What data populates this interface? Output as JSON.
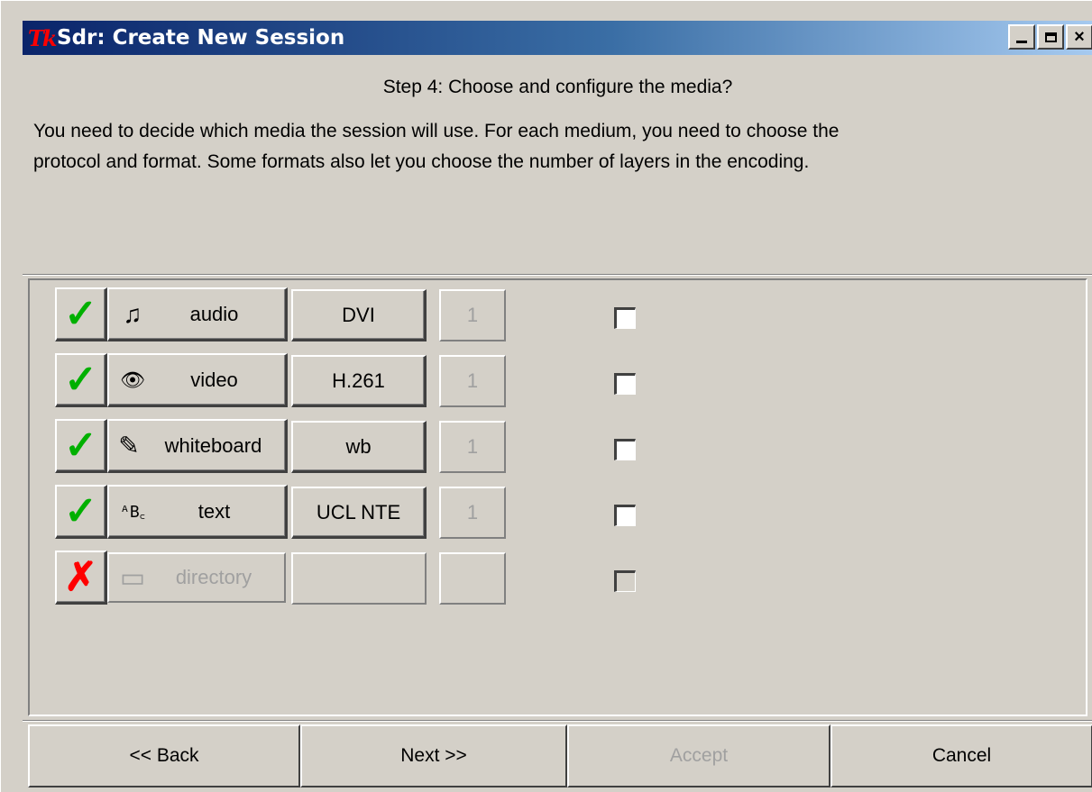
{
  "window": {
    "logo": "Tk",
    "title": "Sdr: Create New Session",
    "controls": {
      "minimize": "minimize",
      "maximize": "maximize",
      "close": "×"
    }
  },
  "step": "Step 4: Choose and configure the media?",
  "description_line1": "You need to decide which media the session will use.  For each medium, you need to choose the",
  "description_line2": "protocol and format.  Some formats also let you choose the number of layers in the encoding.",
  "media": [
    {
      "enabled_mark": "✓",
      "icon": "music-note-icon",
      "icon_glyph": "♫",
      "label": "audio",
      "format": "DVI",
      "layers": "1"
    },
    {
      "enabled_mark": "✓",
      "icon": "eye-icon",
      "icon_glyph": "👁",
      "label": "video",
      "format": "H.261",
      "layers": "1"
    },
    {
      "enabled_mark": "✓",
      "icon": "pen-icon",
      "icon_glyph": "✎",
      "label": "whiteboard",
      "format": "wb",
      "layers": "1"
    },
    {
      "enabled_mark": "✓",
      "icon": "abc-icon",
      "icon_glyph": "ᴬB꜀",
      "label": "text",
      "format": "UCL NTE",
      "layers": "1"
    },
    {
      "enabled_mark": "✗",
      "icon": "folder-icon",
      "icon_glyph": "▭",
      "label": "directory",
      "format": "",
      "layers": ""
    }
  ],
  "buttons": {
    "back": "<< Back",
    "next": "Next >>",
    "accept": "Accept",
    "cancel": "Cancel"
  },
  "colors": {
    "title_gradient_start": "#0a246a",
    "title_gradient_end": "#a6caf0",
    "enabled_check": "#00b000",
    "disabled_x": "#ff0000",
    "face": "#d4d0c8"
  }
}
